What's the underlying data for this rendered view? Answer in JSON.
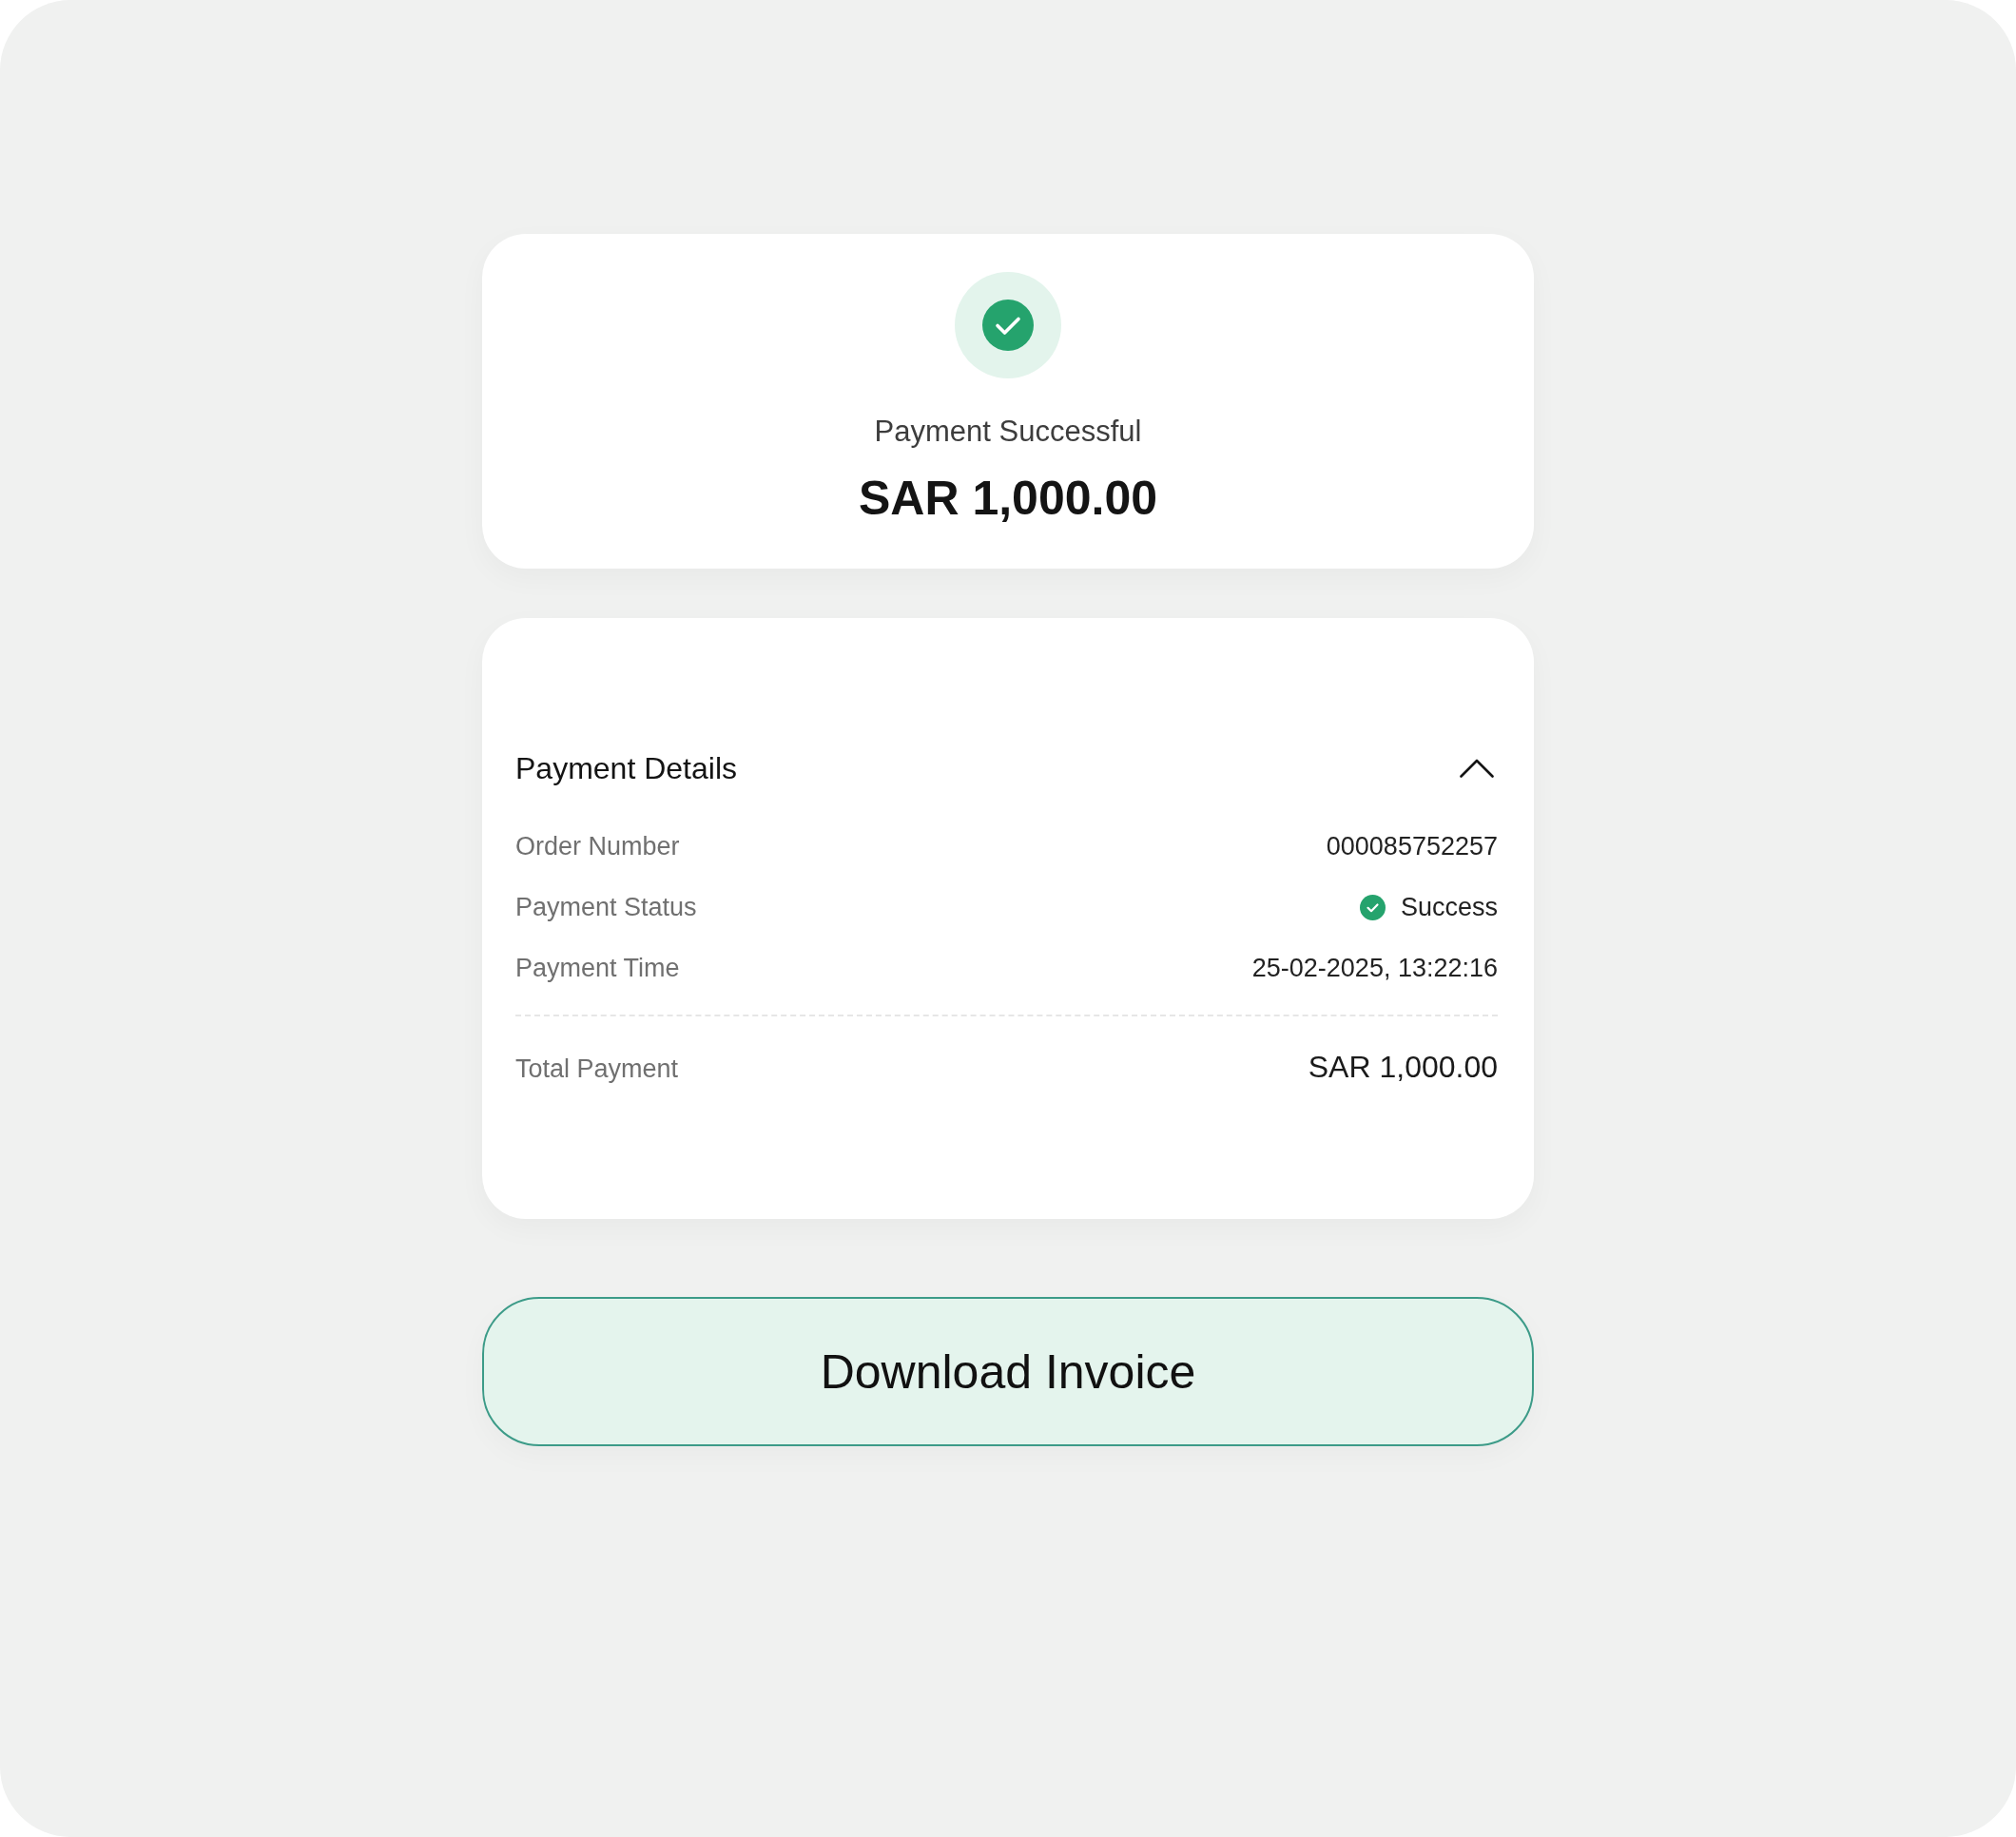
{
  "status": {
    "title": "Payment Successful",
    "amount": "SAR 1,000.00"
  },
  "details": {
    "title": "Payment Details",
    "expanded": true,
    "rows": [
      {
        "kind": "text",
        "label": "Order Number",
        "value": "000085752257"
      },
      {
        "kind": "status",
        "label": "Payment Status",
        "value": "Success"
      },
      {
        "kind": "text",
        "label": "Payment Time",
        "value": "25-02-2025, 13:22:16"
      }
    ],
    "total": {
      "label": "Total Payment",
      "value": "SAR 1,000.00"
    }
  },
  "actions": [
    {
      "label": "Download Invoice"
    }
  ]
}
